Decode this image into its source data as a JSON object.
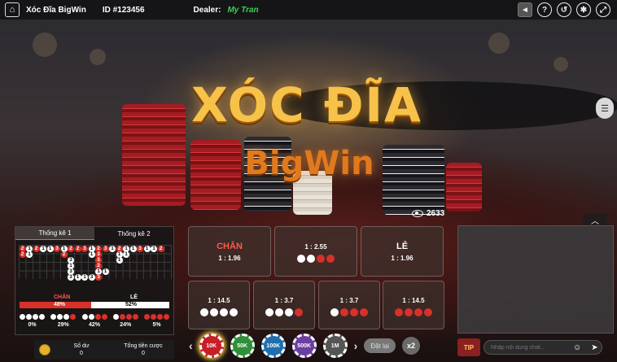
{
  "header": {
    "title": "Xóc Đĩa BigWin",
    "id_label": "ID #123456",
    "dealer_label": "Dealer:",
    "dealer_name": "My Tran",
    "icons": [
      "mute-icon",
      "help-icon",
      "history-icon",
      "settings-icon",
      "fullscreen-icon"
    ]
  },
  "logo": {
    "line1": "XÓC ĐĨA",
    "line2": "BigWin"
  },
  "viewers": "2633",
  "stats": {
    "tabs": [
      "Thống kê 1",
      "Thống kê 2"
    ],
    "even_label": "CHẴN",
    "odd_label": "LẺ",
    "even_pct": "48%",
    "odd_pct": "52%",
    "even_ratio": 0.48,
    "groups": [
      {
        "dots": [
          "w",
          "w",
          "w",
          "w"
        ],
        "pct": "0%"
      },
      {
        "dots": [
          "w",
          "w",
          "w",
          "r"
        ],
        "pct": "29%"
      },
      {
        "dots": [
          "w",
          "w",
          "r",
          "r"
        ],
        "pct": "42%"
      },
      {
        "dots": [
          "w",
          "r",
          "r",
          "r"
        ],
        "pct": "24%"
      },
      {
        "dots": [
          "r",
          "r",
          "r",
          "r"
        ],
        "pct": "5%"
      }
    ]
  },
  "bets": {
    "even": {
      "name": "CHẴN",
      "odds": "1 : 1.96"
    },
    "mid": {
      "odds": "1 : 2.55",
      "dots": [
        "w",
        "w",
        "r",
        "r"
      ]
    },
    "odd": {
      "name": "LẺ",
      "odds": "1 : 1.96"
    },
    "row2": [
      {
        "odds": "1 : 14.5",
        "dots": [
          "w",
          "w",
          "w",
          "w"
        ]
      },
      {
        "odds": "1 : 3.7",
        "dots": [
          "w",
          "w",
          "w",
          "r"
        ]
      },
      {
        "odds": "1 : 3.7",
        "dots": [
          "w",
          "r",
          "r",
          "r"
        ]
      },
      {
        "odds": "1 : 14.5",
        "dots": [
          "r",
          "r",
          "r",
          "r"
        ]
      }
    ]
  },
  "chat": {
    "placeholder": "Nhập nội dung chat...",
    "tip": "TIP"
  },
  "bottom": {
    "balance_label": "Số dư",
    "balance_value": "0",
    "total_bet_label": "Tổng tiền cược",
    "total_bet_value": "0"
  },
  "chips": [
    {
      "label": "10K",
      "color": "#c81e26",
      "selected": true
    },
    {
      "label": "50K",
      "color": "#2f8f3a"
    },
    {
      "label": "100K",
      "color": "#1f6fb0"
    },
    {
      "label": "500K",
      "color": "#6a3fa0"
    },
    {
      "label": "1M",
      "color": "#555555"
    }
  ],
  "controls": {
    "rebet": "Đặt lại",
    "double": "x2"
  }
}
